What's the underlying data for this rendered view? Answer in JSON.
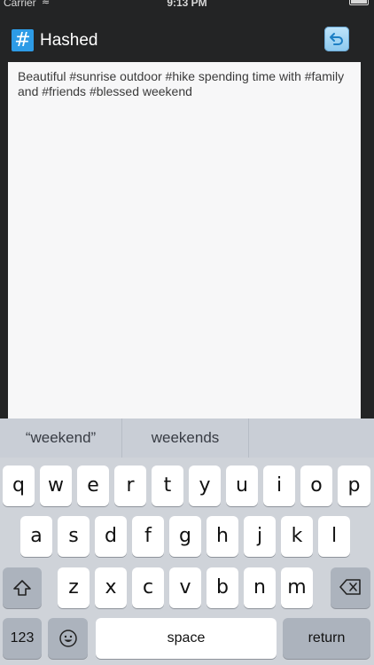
{
  "status": {
    "carrier": "Carrier",
    "time": "9:13 PM"
  },
  "nav": {
    "logo_glyph": "#",
    "title": "Hashed",
    "undo_icon": "undo-icon"
  },
  "editor": {
    "text": "Beautiful #sunrise outdoor #hike spending time with #family and #friends #blessed weekend"
  },
  "keyboard": {
    "suggestions": [
      "“weekend”",
      "weekends",
      ""
    ],
    "row1": [
      "q",
      "w",
      "e",
      "r",
      "t",
      "y",
      "u",
      "i",
      "o",
      "p"
    ],
    "row2": [
      "a",
      "s",
      "d",
      "f",
      "g",
      "h",
      "j",
      "k",
      "l"
    ],
    "row3": [
      "z",
      "x",
      "c",
      "v",
      "b",
      "n",
      "m"
    ],
    "numbers_label": "123",
    "space_label": "space",
    "return_label": "return",
    "shift_icon": "shift-icon",
    "delete_icon": "delete-icon",
    "emoji_icon": "emoji-icon"
  }
}
